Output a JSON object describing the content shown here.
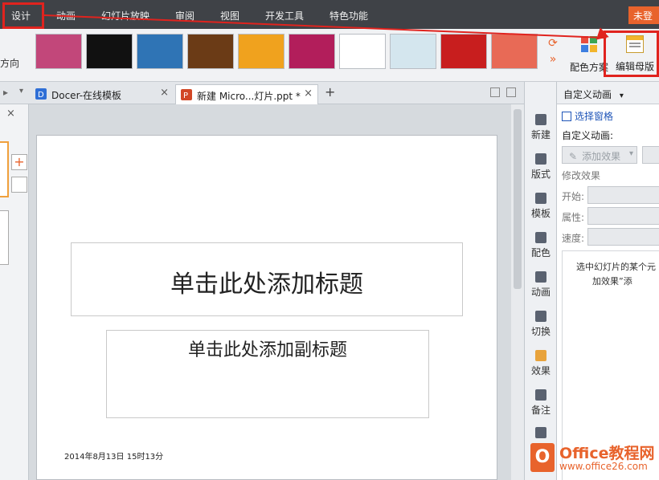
{
  "menubar": {
    "items": [
      "设计",
      "动画",
      "幻灯片放映",
      "审阅",
      "视图",
      "开发工具",
      "特色功能"
    ],
    "guest_label": "未登"
  },
  "ribbon": {
    "left_label": "方向",
    "themes": [
      {
        "name": "theme-1",
        "color": "#c2477a"
      },
      {
        "name": "theme-2",
        "color": "#111111"
      },
      {
        "name": "theme-3",
        "color": "#2f74b5"
      },
      {
        "name": "theme-4",
        "color": "#6b3b16"
      },
      {
        "name": "theme-5",
        "color": "#f0a21e"
      },
      {
        "name": "theme-6",
        "color": "#b21e5b"
      },
      {
        "name": "theme-7",
        "color": "#ffffff"
      },
      {
        "name": "theme-8",
        "color": "#d4e6ee"
      },
      {
        "name": "theme-9",
        "color": "#c81e1e"
      },
      {
        "name": "theme-10",
        "color": "#e86a56"
      }
    ],
    "color_scheme_label": "配色方案",
    "edit_master_label": "编辑母版"
  },
  "tabs": [
    {
      "label": "Docer-在线模板",
      "icon": "docer-icon",
      "close": "×"
    },
    {
      "label": "新建 Micro...灯片.ppt *",
      "icon": "ppt-file-icon",
      "close": "×"
    }
  ],
  "tab_add": "+",
  "leftpane": {
    "close": "×",
    "add": "+"
  },
  "slide": {
    "title_placeholder": "单击此处添加标题",
    "subtitle_placeholder": "单击此处添加副标题",
    "date_text": "2014年8月13日 15时13分"
  },
  "rail": [
    "新建",
    "版式",
    "模板",
    "配色",
    "动画",
    "切换",
    "效果",
    "备注"
  ],
  "animpane": {
    "header": "自定义动画",
    "select_pane": "选择窗格",
    "custom_anim_label": "自定义动画:",
    "add_effect": "添加效果",
    "modify_effect": "修改效果",
    "start_label": "开始:",
    "property_label": "属性:",
    "speed_label": "速度:",
    "hint_line1": "选中幻灯片的某个元",
    "hint_line2": "加效果”添"
  },
  "logo": {
    "title": "Office教程网",
    "url": "www.office26.com"
  },
  "colors": {
    "accent": "#e8632c",
    "annotation": "#e0231e",
    "menubar": "#3f4247"
  }
}
